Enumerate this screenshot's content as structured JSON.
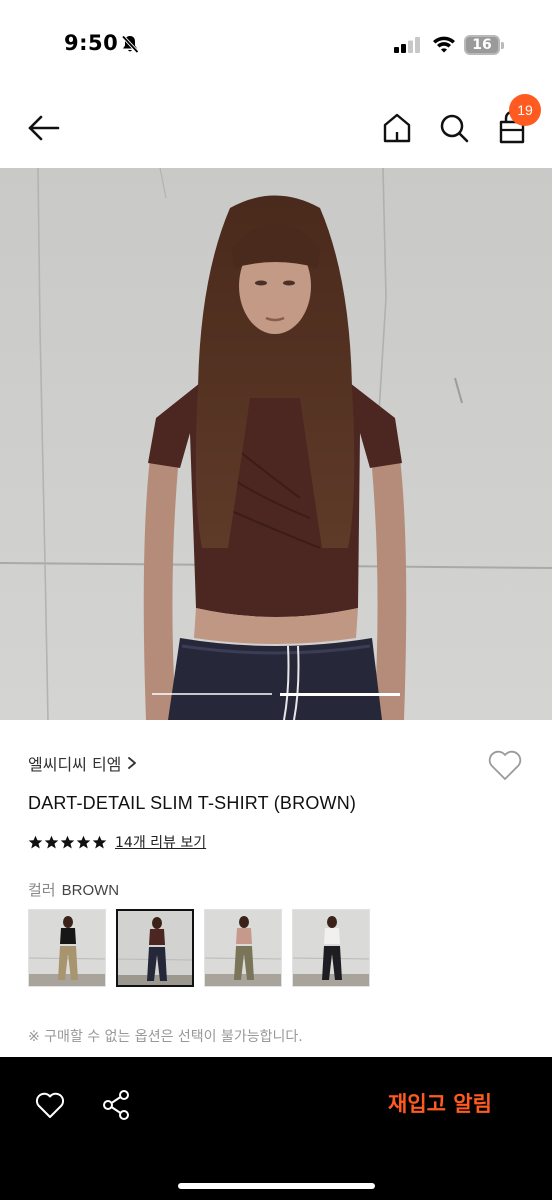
{
  "status_bar": {
    "time": "9:50",
    "battery": "16",
    "icons": [
      "bell-muted-icon",
      "signal-icon",
      "wifi-icon",
      "battery-icon"
    ]
  },
  "header": {
    "icons": [
      "back-arrow-icon",
      "home-icon",
      "search-icon",
      "shopping-bag-icon"
    ],
    "cart_count": "19",
    "badge_color": "#ff5a1f"
  },
  "gallery": {
    "image": "model-wearing-brown-tshirt-photo",
    "slide_count": 2,
    "active_slide": 1
  },
  "product": {
    "brand": "엘씨디씨 티엠",
    "title": "DART-DETAIL SLIM T-SHIRT (BROWN)",
    "rating_stars": 5,
    "review_link": "14개 리뷰 보기",
    "color_label": "컬러",
    "color_value": "BROWN",
    "swatches": [
      {
        "color": "black",
        "selected": false
      },
      {
        "color": "brown",
        "selected": true
      },
      {
        "color": "pink",
        "selected": false
      },
      {
        "color": "white",
        "selected": false
      }
    ],
    "notice": "※ 구매할 수 없는 옵션은 선택이 불가능합니다."
  },
  "bottom_bar": {
    "icons": [
      "heart-icon",
      "share-icon"
    ],
    "restock_label": "재입고 알림",
    "accent": "#ff5a1f"
  }
}
